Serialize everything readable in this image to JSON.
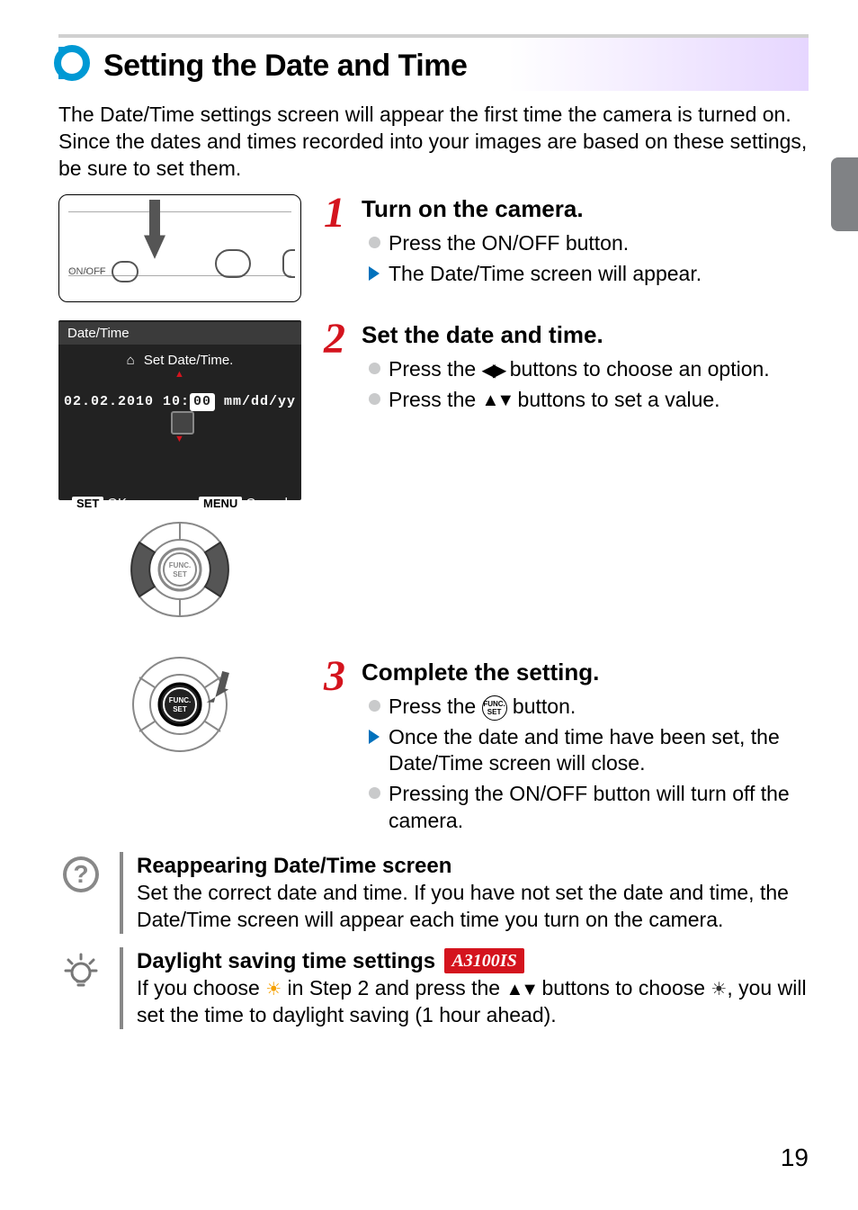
{
  "title": "Setting the Date and Time",
  "intro": "The Date/Time settings screen will appear the first time the camera is turned on. Since the dates and times recorded into your images are based on these settings, be sure to set them.",
  "camera_onoff_label": "ON/OFF",
  "lcd": {
    "title": "Date/Time",
    "set_label": "Set Date/Time.",
    "date_string": "02.02.2010 10:",
    "selected": "00",
    "format": " mm/dd/yy",
    "ok_tag": "SET",
    "ok_text": "OK",
    "cancel_tag": "MENU",
    "cancel_text": "Cancel"
  },
  "step1": {
    "num": "1",
    "title": "Turn on the camera.",
    "bullet1": "Press the ON/OFF button.",
    "bullet2": "The Date/Time screen will appear."
  },
  "step2": {
    "num": "2",
    "title": "Set the date and time.",
    "bullet1a": "Press the ",
    "bullet1b": " buttons to choose an option.",
    "bullet2a": "Press the ",
    "bullet2b": " buttons to set a value."
  },
  "step3": {
    "num": "3",
    "title": "Complete the setting.",
    "bullet1a": "Press the ",
    "bullet1b": " button.",
    "bullet2": "Once the date and time have been set, the Date/Time screen will close.",
    "bullet3": "Pressing the ON/OFF button will turn off the camera."
  },
  "tip_reappear": {
    "title": "Reappearing Date/Time screen",
    "body": "Set the correct date and time. If you have not set the date and time, the Date/Time screen will appear each time you turn on the camera."
  },
  "tip_dst": {
    "title": "Daylight saving time settings",
    "badge": "A3100IS",
    "p1": "If you choose ",
    "p2": " in Step 2 and press the ",
    "p3": " buttons to choose ",
    "p4": ", you will set the time to daylight saving (1 hour ahead)."
  },
  "func_label_top": "FUNC.",
  "func_label_bot": "SET",
  "page_number": "19"
}
